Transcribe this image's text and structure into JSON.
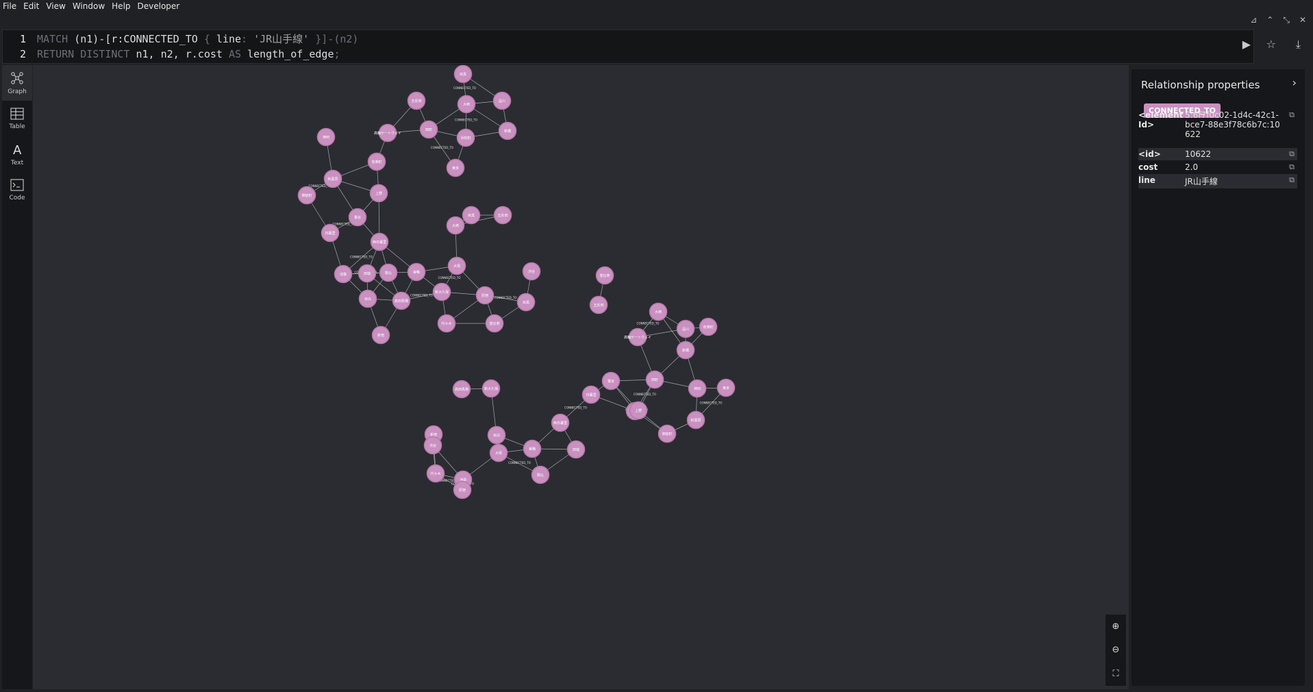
{
  "menu": [
    "File",
    "Edit",
    "View",
    "Window",
    "Help",
    "Developer"
  ],
  "editor": {
    "lines": [
      {
        "num": "1",
        "parts": [
          {
            "c": "kw",
            "t": "MATCH "
          },
          {
            "c": "tx",
            "t": "(n1)-[r:CONNECTED_TO "
          },
          {
            "c": "kw",
            "t": "{ "
          },
          {
            "c": "tx",
            "t": "line"
          },
          {
            "c": "kw",
            "t": ": "
          },
          {
            "c": "str",
            "t": "'JR山手線'"
          },
          {
            "c": "kw",
            "t": " }]-(n2)"
          }
        ]
      },
      {
        "num": "2",
        "parts": [
          {
            "c": "kw",
            "t": "RETURN DISTINCT "
          },
          {
            "c": "tx",
            "t": "n1, n2, r.cost "
          },
          {
            "c": "kw",
            "t": "AS "
          },
          {
            "c": "tx",
            "t": "length_of_edge"
          },
          {
            "c": "kw",
            "t": ";"
          }
        ]
      }
    ]
  },
  "editor_actions": {
    "run_icon": "play-icon",
    "favorite_icon": "star-icon",
    "download_icon": "download-icon"
  },
  "window_controls": [
    "pin-icon",
    "chevron-up-icon",
    "shrink-icon",
    "close-icon"
  ],
  "sidebar": [
    {
      "label": "Graph",
      "icon": "graph-icon",
      "active": true
    },
    {
      "label": "Table",
      "icon": "table-icon",
      "active": false
    },
    {
      "label": "Text",
      "icon": "text-icon",
      "active": false
    },
    {
      "label": "Code",
      "icon": "code-icon",
      "active": false
    }
  ],
  "panel": {
    "title": "Relationship properties",
    "badge": "CONNECTED_TO",
    "props": [
      {
        "key": "<element Id>",
        "value": "5:6f7f0c02-1d4c-42c1-bce7-88e3f78c6b7c:10622"
      },
      {
        "key": "<id>",
        "value": "10622"
      },
      {
        "key": "cost",
        "value": "2.0"
      },
      {
        "key": "line",
        "value": "JR山手線"
      }
    ]
  },
  "graph": {
    "node_color": "#c990c0",
    "edge_label": "CONNECTED_TO",
    "nodes": [
      "目黒",
      "五反田",
      "大崎",
      "品川",
      "高輪ゲートウェイ",
      "田町",
      "浜松町",
      "新橋",
      "有楽町",
      "東京",
      "神田",
      "秋葉原",
      "御徒町",
      "上野",
      "鶯谷",
      "日暮里",
      "西日暮里",
      "田端",
      "駒込",
      "巣鴨",
      "大塚",
      "池袋",
      "目白",
      "高田馬場",
      "新大久保",
      "新宿",
      "代々木",
      "原宿",
      "渋谷",
      "恵比寿"
    ]
  },
  "zoom": [
    "zoom-in-icon",
    "zoom-out-icon",
    "fit-icon"
  ]
}
